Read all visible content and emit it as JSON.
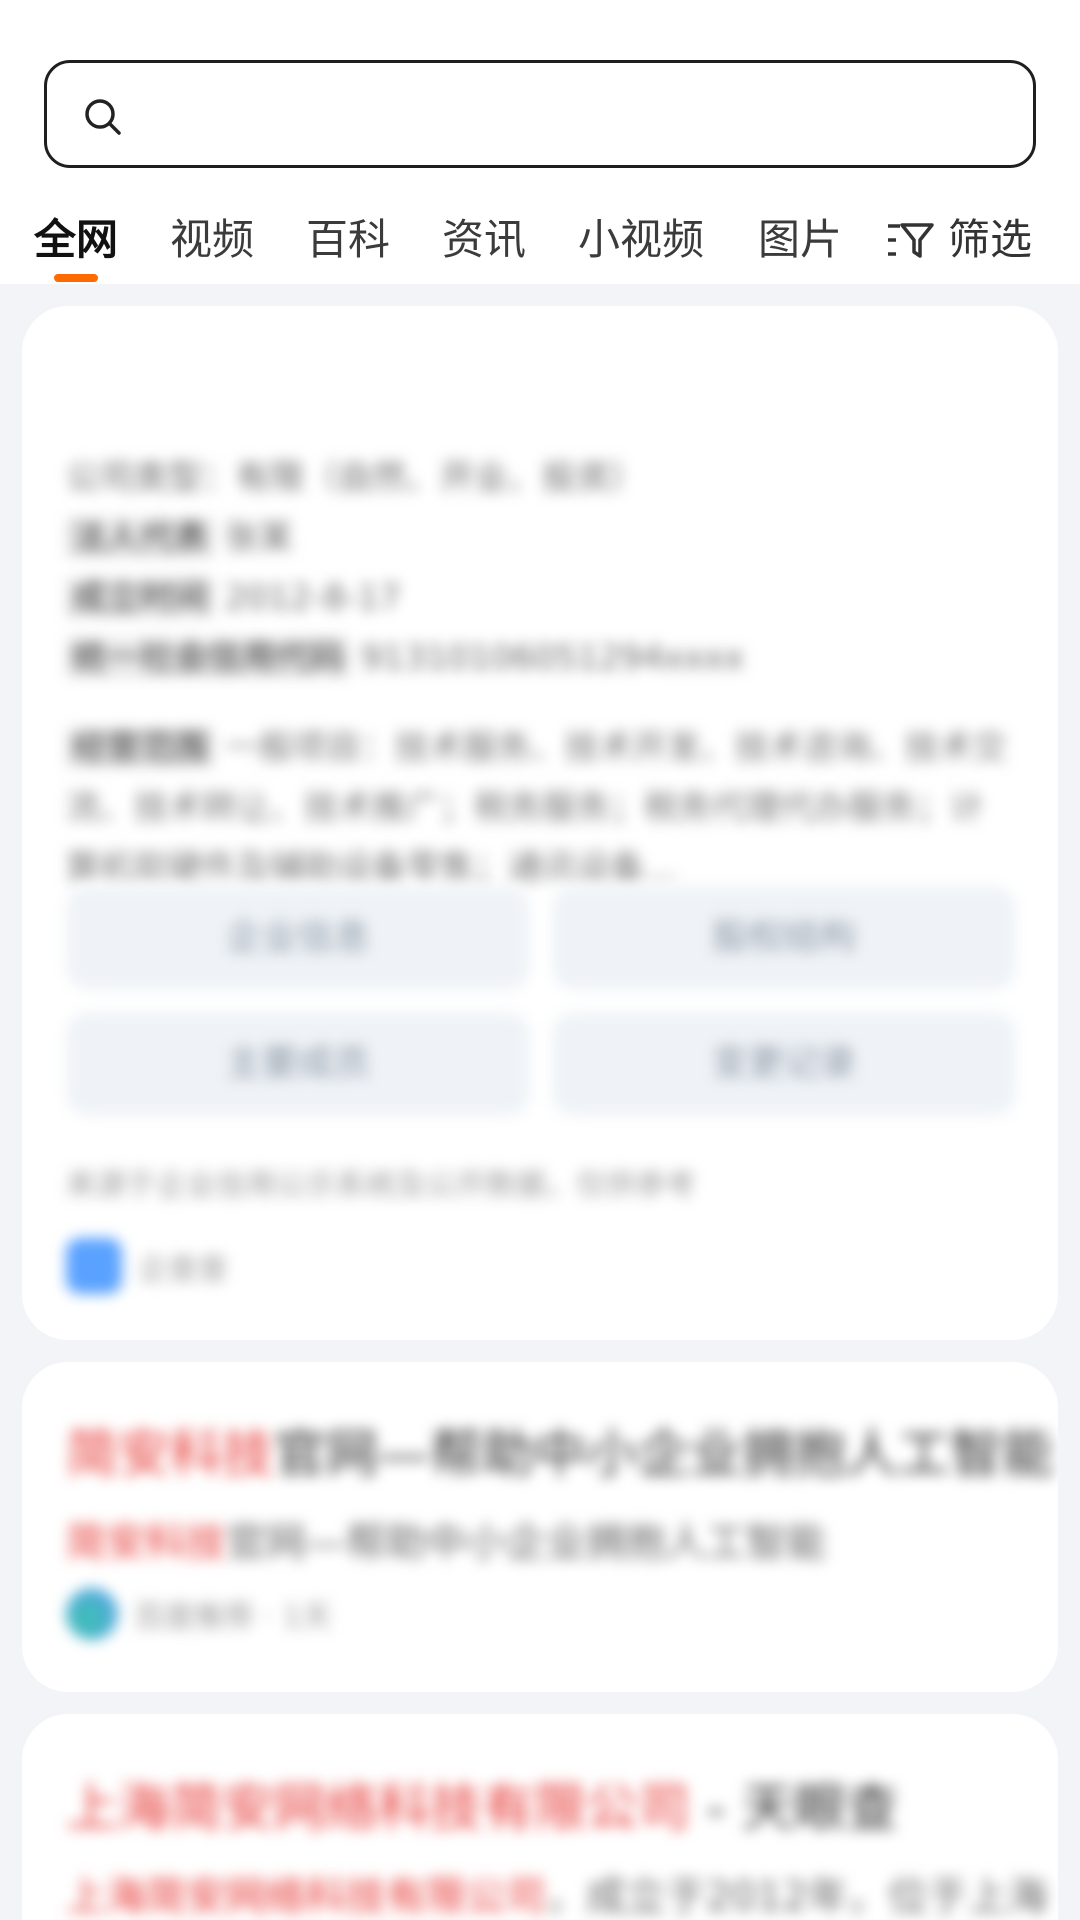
{
  "search": {
    "value": "",
    "placeholder": ""
  },
  "tabs": [
    {
      "label": "全网",
      "active": true
    },
    {
      "label": "视频",
      "active": false
    },
    {
      "label": "百科",
      "active": false
    },
    {
      "label": "资讯",
      "active": false
    },
    {
      "label": "小视频",
      "active": false
    },
    {
      "label": "图片",
      "active": false
    }
  ],
  "filter": {
    "label": "筛选",
    "icon": "filter-icon"
  },
  "colors": {
    "accent": "#ff6a00",
    "highlight": "#e53935",
    "grid_button_bg": "#eff3f7"
  },
  "card1": {
    "lines": [
      {
        "key": "",
        "value": "公司类型：有限（自然、开业、投资）"
      },
      {
        "key": "法人代表",
        "value": "张某"
      },
      {
        "key": "成立时间",
        "value": "2012-8-17"
      },
      {
        "key": "统一社会信用代码",
        "value": "91310106051294xxxx"
      }
    ],
    "scope": {
      "key": "经营范围",
      "value": "一般项目：技术服务、技术开发、技术咨询、技术交流、技术转让、技术推广；税务服务；税务代理代办服务；计算机软硬件及辅助设备零售；通讯设备..."
    },
    "buttons": [
      "企业信息",
      "股权结构",
      "主要成员",
      "变更记录"
    ],
    "description": "来源于企业信用公示系统及公开数据，仅供参考",
    "source": {
      "name": "企查查"
    }
  },
  "card2": {
    "title_highlight": "简安科技",
    "title_rest": "官网—帮助中小企业拥抱人工智能",
    "subtitle_highlight": "简安科技",
    "subtitle_rest": "官网—帮助中小企业拥抱人工智能",
    "source": {
      "name": "百度推荐 · 1天"
    }
  },
  "card3": {
    "title_highlight": "上海简安网络科技有限公司",
    "title_rest": " - 天眼查",
    "subtitle_highlight": "上海简安网络科技有限公司",
    "subtitle_rest": "，成立于2012年，位于上海"
  }
}
